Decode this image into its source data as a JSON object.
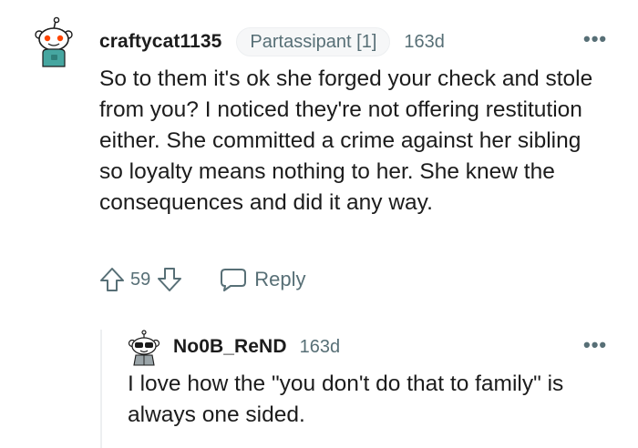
{
  "comment": {
    "username": "craftycat1135",
    "flair": "Partassipant [1]",
    "timestamp": "163d",
    "more_label": "•••",
    "body": "So to them it's ok she forged your check and stole from you? I noticed they're not offering restitution either. She committed a crime against her sibling so loyalty means nothing to her. She knew the consequences and did it any way.",
    "score": "59",
    "reply_label": "Reply",
    "avatar_icon": "snoo-avatar-icon",
    "upvote_icon": "upvote-arrow-icon",
    "downvote_icon": "downvote-arrow-icon",
    "reply_icon": "speech-bubble-icon"
  },
  "reply": {
    "username": "No0B_ReND",
    "timestamp": "163d",
    "more_label": "•••",
    "body": "I love how the \"you don't do that to family\" is always one sided.",
    "avatar_icon": "snoo-avatar-icon"
  },
  "colors": {
    "text": "#1c1c1c",
    "meta": "#576f76",
    "flair_bg": "#f6f7f8",
    "thread_line": "#edeff1",
    "snoo_orange": "#ff4500",
    "snoo_teal": "#46a6a0"
  }
}
